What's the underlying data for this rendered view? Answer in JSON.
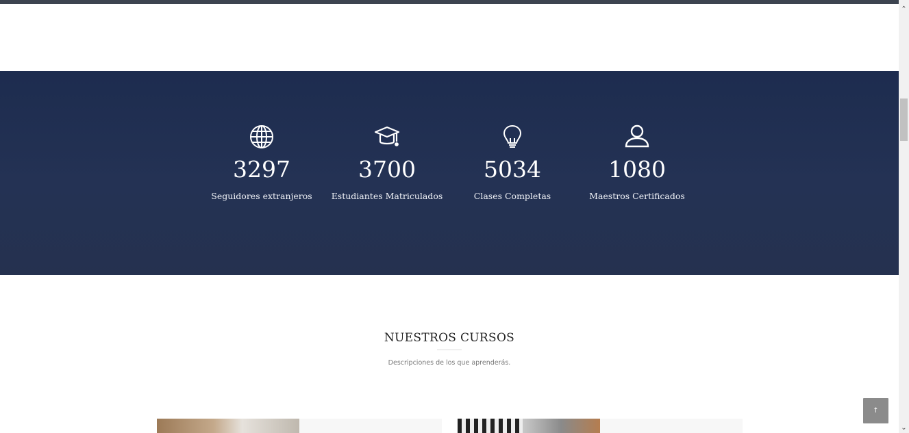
{
  "stats": [
    {
      "icon": "globe-icon",
      "value": "3297",
      "label": "Seguidores extranjeros"
    },
    {
      "icon": "graduation-cap-icon",
      "value": "3700",
      "label": "Estudiantes Matriculados"
    },
    {
      "icon": "lightbulb-icon",
      "value": "5034",
      "label": "Clases Completas"
    },
    {
      "icon": "user-icon",
      "value": "1080",
      "label": "Maestros Certificados"
    }
  ],
  "courses_section": {
    "title": "NUESTROS CURSOS",
    "subtitle": "Descripciones de los que aprenderás."
  },
  "scroll_top_button": {
    "symbol": "↑"
  },
  "scrollbar": {
    "up_symbol": "⌃",
    "down_symbol": "⌄"
  },
  "colors": {
    "stats_band": "#1f2e50",
    "top_bar": "#3d4450",
    "to_top_button": "#8b8b8b"
  }
}
